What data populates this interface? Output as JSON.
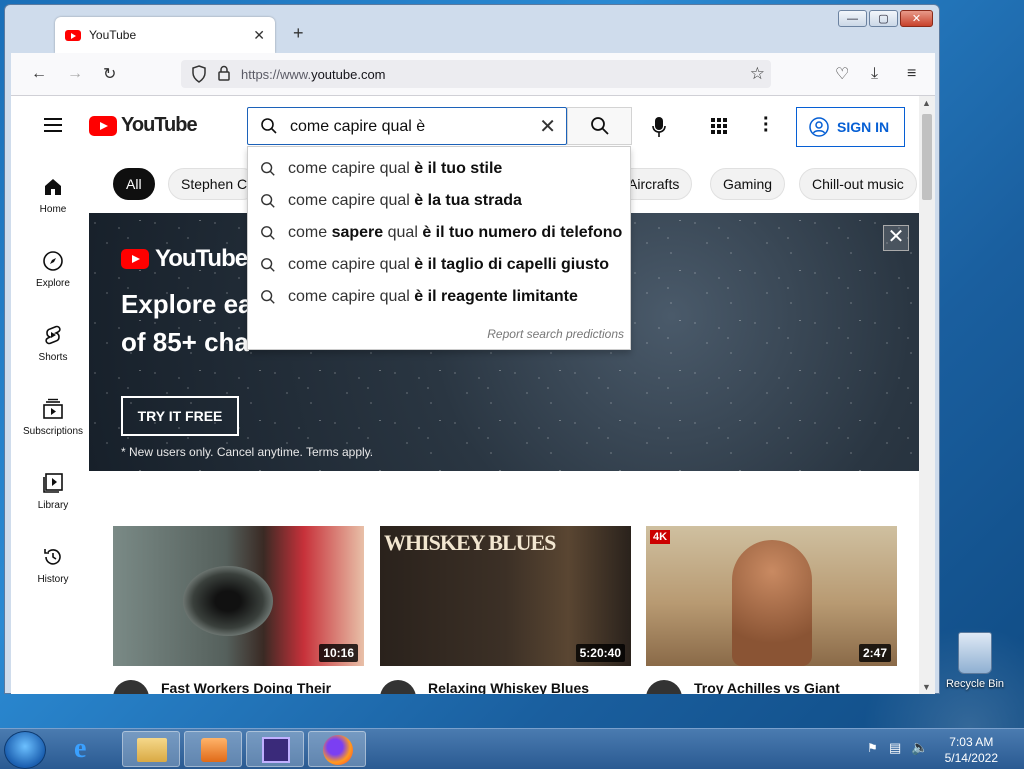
{
  "browser": {
    "tab_title": "YouTube",
    "url_prefix": "https://www.",
    "url_domain": "youtube.com"
  },
  "youtube": {
    "logo_text": "YouTube",
    "search_value": "come capire qual è",
    "sign_in_label": "SIGN IN",
    "sidebar": [
      {
        "label": "Home",
        "icon": "home-icon"
      },
      {
        "label": "Explore",
        "icon": "compass-icon"
      },
      {
        "label": "Shorts",
        "icon": "shorts-icon"
      },
      {
        "label": "Subscriptions",
        "icon": "subscriptions-icon"
      },
      {
        "label": "Library",
        "icon": "library-icon"
      },
      {
        "label": "History",
        "icon": "history-icon"
      }
    ],
    "chips": [
      "All",
      "Stephen C",
      "Aircrafts",
      "Gaming",
      "Chill-out music"
    ],
    "suggestions": [
      {
        "plain": "come capire qual ",
        "bold": "è il tuo stile"
      },
      {
        "plain": "come capire qual ",
        "bold": "è la tua strada"
      },
      {
        "plain": "come ",
        "bold": "sapere",
        "plain2": " qual ",
        "bold2": "è il tuo numero di telefono"
      },
      {
        "plain": "come capire qual ",
        "bold": "è il taglio di capelli giusto"
      },
      {
        "plain": "come capire qual ",
        "bold": "è il reagente limitante"
      }
    ],
    "report_predictions": "Report search predictions",
    "banner": {
      "logo_text": "YouTubeTV",
      "headline_line1": "Explore ea",
      "headline_line2": "of 85+ cha",
      "button_label": "TRY IT FREE",
      "note": "* New users only. Cancel anytime. Terms apply."
    },
    "videos": [
      {
        "title": "Fast Workers Doing Their",
        "duration": "10:16"
      },
      {
        "title": "Relaxing Whiskey Blues",
        "duration": "5:20:40",
        "thumb_text": "WHISKEY BLUES"
      },
      {
        "title": "Troy Achilles vs Giant",
        "duration": "2:47",
        "badge": "4K"
      }
    ]
  },
  "desktop": {
    "recycle_bin_label": "Recycle Bin",
    "clock_time": "7:03 AM",
    "clock_date": "5/14/2022"
  },
  "colors": {
    "youtube_red": "#ff0000",
    "sign_in_blue": "#065fd4",
    "search_border": "#1c62b9"
  }
}
